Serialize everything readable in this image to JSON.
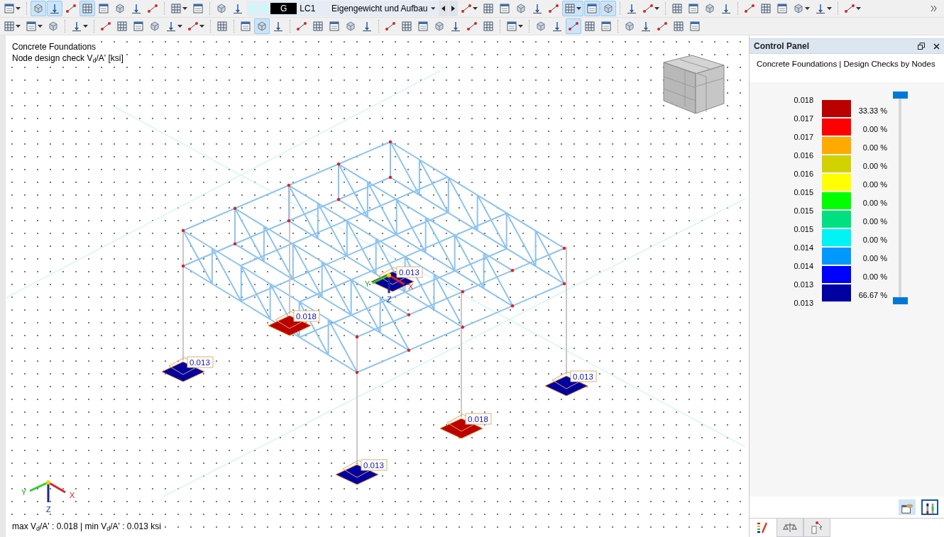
{
  "toolbar_rows": [
    [
      {
        "kind": "button",
        "selected": false,
        "dropdown": true
      },
      {
        "kind": "separator"
      },
      {
        "kind": "button",
        "selected": true
      },
      {
        "kind": "button",
        "selected": true
      },
      {
        "kind": "button",
        "selected": false
      },
      {
        "kind": "button",
        "selected": true
      },
      {
        "kind": "button",
        "selected": false
      },
      {
        "kind": "button",
        "selected": false
      },
      {
        "kind": "button",
        "selected": false
      },
      {
        "kind": "button",
        "selected": false
      },
      {
        "kind": "separator"
      },
      {
        "kind": "button",
        "selected": false,
        "dropdown": true
      },
      {
        "kind": "button",
        "selected": false
      },
      {
        "kind": "separator"
      },
      {
        "kind": "button",
        "selected": false
      },
      {
        "kind": "button",
        "selected": false
      },
      {
        "kind": "combo"
      },
      {
        "kind": "button",
        "selected": false,
        "dropdown": true
      },
      {
        "kind": "button",
        "selected": false
      },
      {
        "kind": "button",
        "selected": false
      },
      {
        "kind": "button",
        "selected": false
      },
      {
        "kind": "button",
        "selected": false
      },
      {
        "kind": "button",
        "selected": false
      },
      {
        "kind": "button",
        "selected": true,
        "dropdown": true
      },
      {
        "kind": "button",
        "selected": true
      },
      {
        "kind": "button",
        "selected": true
      },
      {
        "kind": "separator"
      },
      {
        "kind": "button",
        "selected": false
      },
      {
        "kind": "button",
        "selected": false,
        "dropdown": true
      },
      {
        "kind": "separator"
      },
      {
        "kind": "button",
        "selected": false
      },
      {
        "kind": "button",
        "selected": false
      },
      {
        "kind": "button",
        "selected": false
      },
      {
        "kind": "button",
        "selected": false
      },
      {
        "kind": "separator"
      },
      {
        "kind": "button",
        "selected": false
      },
      {
        "kind": "button",
        "selected": false
      },
      {
        "kind": "button",
        "selected": false
      },
      {
        "kind": "button",
        "selected": false,
        "dropdown": true
      },
      {
        "kind": "button",
        "selected": false,
        "dropdown": true
      },
      {
        "kind": "separator"
      },
      {
        "kind": "button",
        "selected": false,
        "dropdown": true
      }
    ],
    [
      {
        "kind": "button",
        "selected": false,
        "dropdown": true
      },
      {
        "kind": "button",
        "selected": false,
        "dropdown": true
      },
      {
        "kind": "button",
        "selected": false
      },
      {
        "kind": "separator"
      },
      {
        "kind": "button",
        "selected": false,
        "dropdown": true
      },
      {
        "kind": "separator"
      },
      {
        "kind": "button",
        "selected": false
      },
      {
        "kind": "button",
        "selected": false
      },
      {
        "kind": "button",
        "selected": false
      },
      {
        "kind": "button",
        "selected": false
      },
      {
        "kind": "button",
        "selected": false,
        "dropdown": true
      },
      {
        "kind": "button",
        "selected": false,
        "dropdown": true
      },
      {
        "kind": "separator"
      },
      {
        "kind": "button",
        "selected": false
      },
      {
        "kind": "separator"
      },
      {
        "kind": "button",
        "selected": false
      },
      {
        "kind": "button",
        "selected": true
      },
      {
        "kind": "button",
        "selected": false
      },
      {
        "kind": "separator"
      },
      {
        "kind": "button",
        "selected": false
      },
      {
        "kind": "button",
        "selected": false
      },
      {
        "kind": "button",
        "selected": false
      },
      {
        "kind": "button",
        "selected": false
      },
      {
        "kind": "button",
        "selected": false
      },
      {
        "kind": "separator"
      },
      {
        "kind": "button",
        "selected": false
      },
      {
        "kind": "button",
        "selected": false
      },
      {
        "kind": "button",
        "selected": false
      },
      {
        "kind": "button",
        "selected": false
      },
      {
        "kind": "button",
        "selected": false
      },
      {
        "kind": "button",
        "selected": false
      },
      {
        "kind": "button",
        "selected": false
      },
      {
        "kind": "separator"
      },
      {
        "kind": "button",
        "selected": false,
        "dropdown": true
      },
      {
        "kind": "separator"
      },
      {
        "kind": "button",
        "selected": false
      },
      {
        "kind": "button",
        "selected": false
      },
      {
        "kind": "button",
        "selected": true
      },
      {
        "kind": "button",
        "selected": false
      },
      {
        "kind": "button",
        "selected": false
      },
      {
        "kind": "separator"
      },
      {
        "kind": "button",
        "selected": false
      },
      {
        "kind": "button",
        "selected": false
      },
      {
        "kind": "button",
        "selected": false
      },
      {
        "kind": "button",
        "selected": false
      },
      {
        "kind": "button",
        "selected": false
      }
    ]
  ],
  "load_case": {
    "type": "G",
    "number": "LC1",
    "name": "Eigengewicht und Aufbau"
  },
  "viewport": {
    "title": "Concrete Foundations",
    "subtitle": "Node design check V$_{d}$/A' [ksi]",
    "footings": [
      {
        "value": "0.013",
        "color": "#0000a0"
      },
      {
        "value": "0.018",
        "color": "#bb0000"
      },
      {
        "value": "0.013",
        "color": "#0000a0"
      },
      {
        "value": "0.013",
        "color": "#0000a0"
      },
      {
        "value": "0.018",
        "color": "#bb0000"
      },
      {
        "value": "0.013",
        "color": "#0000a0"
      }
    ],
    "node_axis_labels": [
      "Y",
      "X",
      "Z"
    ],
    "axis_labels": [
      "Y",
      "X",
      "Z"
    ],
    "summary": "max V$_{d}$/A' : 0.018 | min V$_{d}$/A' : 0.013 ksi"
  },
  "control_panel": {
    "title": "Control Panel",
    "subtitle": "Concrete Foundations | Design Checks by Nodes",
    "scale_values": [
      "0.018",
      "0.017",
      "0.017",
      "0.016",
      "0.016",
      "0.015",
      "0.015",
      "0.015",
      "0.014",
      "0.014",
      "0.013",
      "0.013"
    ],
    "bands": [
      {
        "color": "#bb0000",
        "share": "33.33 %"
      },
      {
        "color": "#ff0000",
        "share": "0.00 %"
      },
      {
        "color": "#ffaa00",
        "share": "0.00 %"
      },
      {
        "color": "#d2d200",
        "share": "0.00 %"
      },
      {
        "color": "#ffff00",
        "share": "0.00 %"
      },
      {
        "color": "#00ff00",
        "share": "0.00 %"
      },
      {
        "color": "#00e080",
        "share": "0.00 %"
      },
      {
        "color": "#00f4f4",
        "share": "0.00 %"
      },
      {
        "color": "#0099ff",
        "share": "0.00 %"
      },
      {
        "color": "#0000ff",
        "share": "0.00 %"
      },
      {
        "color": "#0000a0",
        "share": "66.67 %"
      }
    ],
    "slider_handles": [
      {
        "level": 1
      },
      {
        "level": 0
      }
    ],
    "buttons": [
      {
        "selected": false
      },
      {
        "selected": true
      }
    ],
    "tabs": [
      {
        "selected": true
      },
      {
        "selected": false
      },
      {
        "selected": false
      }
    ]
  }
}
